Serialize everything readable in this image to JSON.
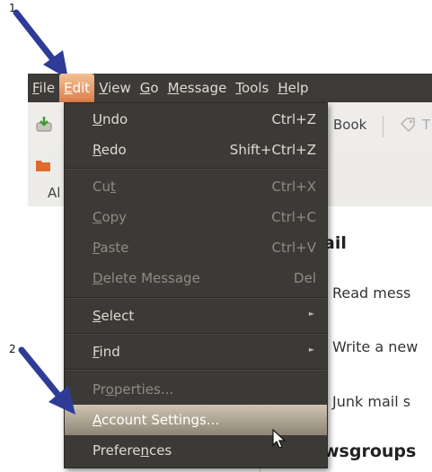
{
  "annotations": {
    "step1": "1",
    "step2": "2"
  },
  "menubar": {
    "items": [
      {
        "label": "File",
        "key": "F",
        "rest": "ile"
      },
      {
        "label": "Edit",
        "key": "E",
        "rest": "dit"
      },
      {
        "label": "View",
        "key": "V",
        "rest": "iew"
      },
      {
        "label": "Go",
        "key": "G",
        "rest": "o"
      },
      {
        "label": "Message",
        "key": "M",
        "rest": "essage"
      },
      {
        "label": "Tools",
        "key": "T",
        "rest": "ools"
      },
      {
        "label": "Help",
        "key": "H",
        "rest": "elp"
      }
    ]
  },
  "toolbar": {
    "address_book_label": "Book",
    "tag_partial": "T"
  },
  "tabs": {
    "partial_label": "Al"
  },
  "content": {
    "heading_mail": "ail",
    "read_text": "Read mess",
    "write_text": "Write a new",
    "junk_text": "Junk mail s",
    "heading_newsgroups": "wsgroups"
  },
  "edit_menu": {
    "undo": {
      "pre": "",
      "key": "U",
      "post": "ndo",
      "shortcut": "Ctrl+Z"
    },
    "redo": {
      "pre": "",
      "key": "R",
      "post": "edo",
      "shortcut": "Shift+Ctrl+Z"
    },
    "cut": {
      "pre": "Cu",
      "key": "t",
      "post": "",
      "shortcut": "Ctrl+X"
    },
    "copy": {
      "pre": "",
      "key": "C",
      "post": "opy",
      "shortcut": "Ctrl+C"
    },
    "paste": {
      "pre": "",
      "key": "P",
      "post": "aste",
      "shortcut": "Ctrl+V"
    },
    "delete_message": {
      "pre": "",
      "key": "D",
      "post": "elete Message",
      "shortcut": "Del"
    },
    "select": {
      "pre": "",
      "key": "S",
      "post": "elect"
    },
    "find": {
      "pre": "",
      "key": "F",
      "post": "ind"
    },
    "properties": {
      "pre": "Pr",
      "key": "o",
      "post": "perties..."
    },
    "account_settings": {
      "pre": "",
      "key": "A",
      "post": "ccount Settings..."
    },
    "preferences": {
      "pre": "Prefere",
      "key": "n",
      "post": "ces"
    }
  },
  "colors": {
    "menu_bg": "#3b3a36",
    "active_menu": "#dd7e4a",
    "highlight": "#a89f8f",
    "arrow": "#2e3c98"
  }
}
